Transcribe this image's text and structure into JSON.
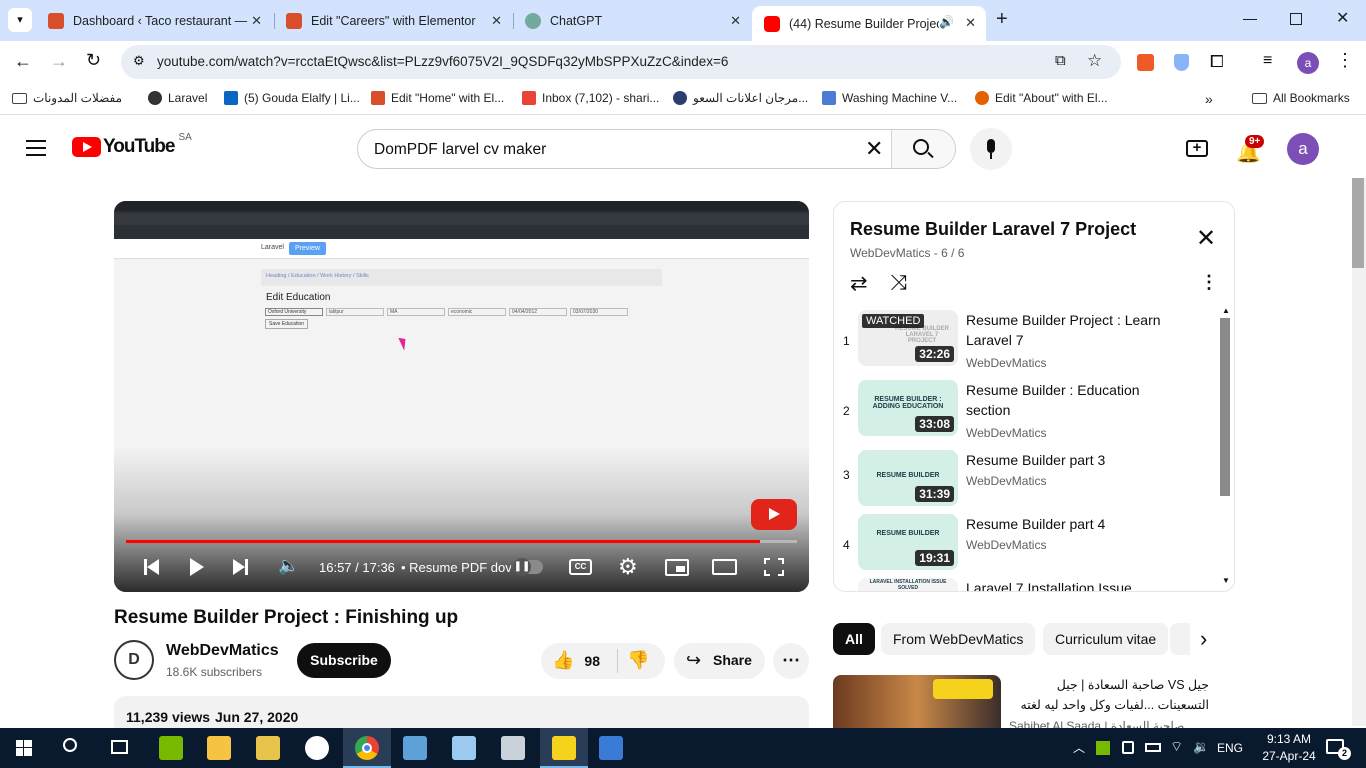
{
  "browser": {
    "tabs": [
      {
        "title": "Dashboard ‹ Taco restaurant —",
        "color": "#d84d2a"
      },
      {
        "title": "Edit \"Careers\" with Elementor",
        "color": "#d84d2a"
      },
      {
        "title": "ChatGPT",
        "color": "#74aa9c"
      },
      {
        "title": "(44) Resume Builder Project",
        "color": "#ff0000"
      }
    ],
    "url": "youtube.com/watch?v=rcctaEtQwsc&list=PLzz9vf6075V2I_9QSDFq32yMbSPPXuZzC&index=6",
    "profile_letter": "a",
    "bookmarks": [
      "مفضلات المدونات",
      "Laravel",
      "(5) Gouda Elalfy | Li...",
      "Edit \"Home\" with El...",
      "Inbox (7,102) - shari...",
      "مرجان اعلانات السعو...",
      "Washing Machine V...",
      "Edit \"About\" with El..."
    ],
    "all_bookmarks": "All Bookmarks"
  },
  "youtube": {
    "logo_text": "YouTube",
    "region": "SA",
    "search_value": "DomPDF  larvel cv maker",
    "notif_count": "9+",
    "avatar_letter": "a"
  },
  "video": {
    "time": "16:57 / 17:36",
    "chapter": "• Resume PDF dov",
    "progress": 0.945,
    "inner": {
      "nav_brand": "Laravel",
      "nav_preview": "Preview",
      "breadcrumb": "Heading  /  Education  /  Work History  /  Skills",
      "heading": "Edit Education",
      "fields": [
        "Oxford University",
        "lalitpur",
        "MA",
        "economic",
        "04/04/2012",
        "03/07/2030"
      ],
      "save": "Save Education"
    }
  },
  "meta": {
    "title": "Resume Builder Project : Finishing up",
    "channel": "WebDevMatics",
    "subscribers": "18.6K subscribers",
    "subscribe": "Subscribe",
    "likes": "98",
    "share": "Share",
    "views": "11,239 views",
    "date": "Jun 27, 2020"
  },
  "playlist": {
    "title": "Resume Builder Laravel 7 Project",
    "subtitle": "WebDevMatics - 6 / 6",
    "items": [
      {
        "num": "1",
        "title": "Resume Builder Project : Learn Laravel 7",
        "channel": "WebDevMatics",
        "duration": "32:26",
        "badge": "WATCHED",
        "thumb_text": "RESUME BUILDER LARAVEL 7 PROJECT"
      },
      {
        "num": "2",
        "title": "Resume Builder : Education section",
        "channel": "WebDevMatics",
        "duration": "33:08",
        "badge": "",
        "thumb_text": "RESUME BUILDER : ADDING EDUCATION"
      },
      {
        "num": "3",
        "title": "Resume Builder part 3",
        "channel": "WebDevMatics",
        "duration": "31:39",
        "badge": "",
        "thumb_text": "RESUME BUILDER"
      },
      {
        "num": "4",
        "title": "Resume Builder part 4",
        "channel": "WebDevMatics",
        "duration": "19:31",
        "badge": "",
        "thumb_text": "RESUME BUILDER"
      },
      {
        "num": "",
        "title": "Laravel 7 Installation Issue",
        "channel": "",
        "duration": "",
        "badge": "",
        "thumb_text": "LARAVEL INSTALLATION ISSUE SOLVED"
      }
    ]
  },
  "chips": [
    "All",
    "From WebDevMatics",
    "Curriculum vitae"
  ],
  "recommended": {
    "title": "جيل VS صاحبة السعادة | جيل التسعينات ...لفيات وكل واحد ليه لغته الخاصة😂..مين",
    "channel": "Sahibet Al Saada | صاحبة السعادة"
  },
  "taskbar": {
    "lang": "ENG",
    "time": "9:13 AM",
    "date": "27-Apr-24",
    "notif": "2"
  }
}
